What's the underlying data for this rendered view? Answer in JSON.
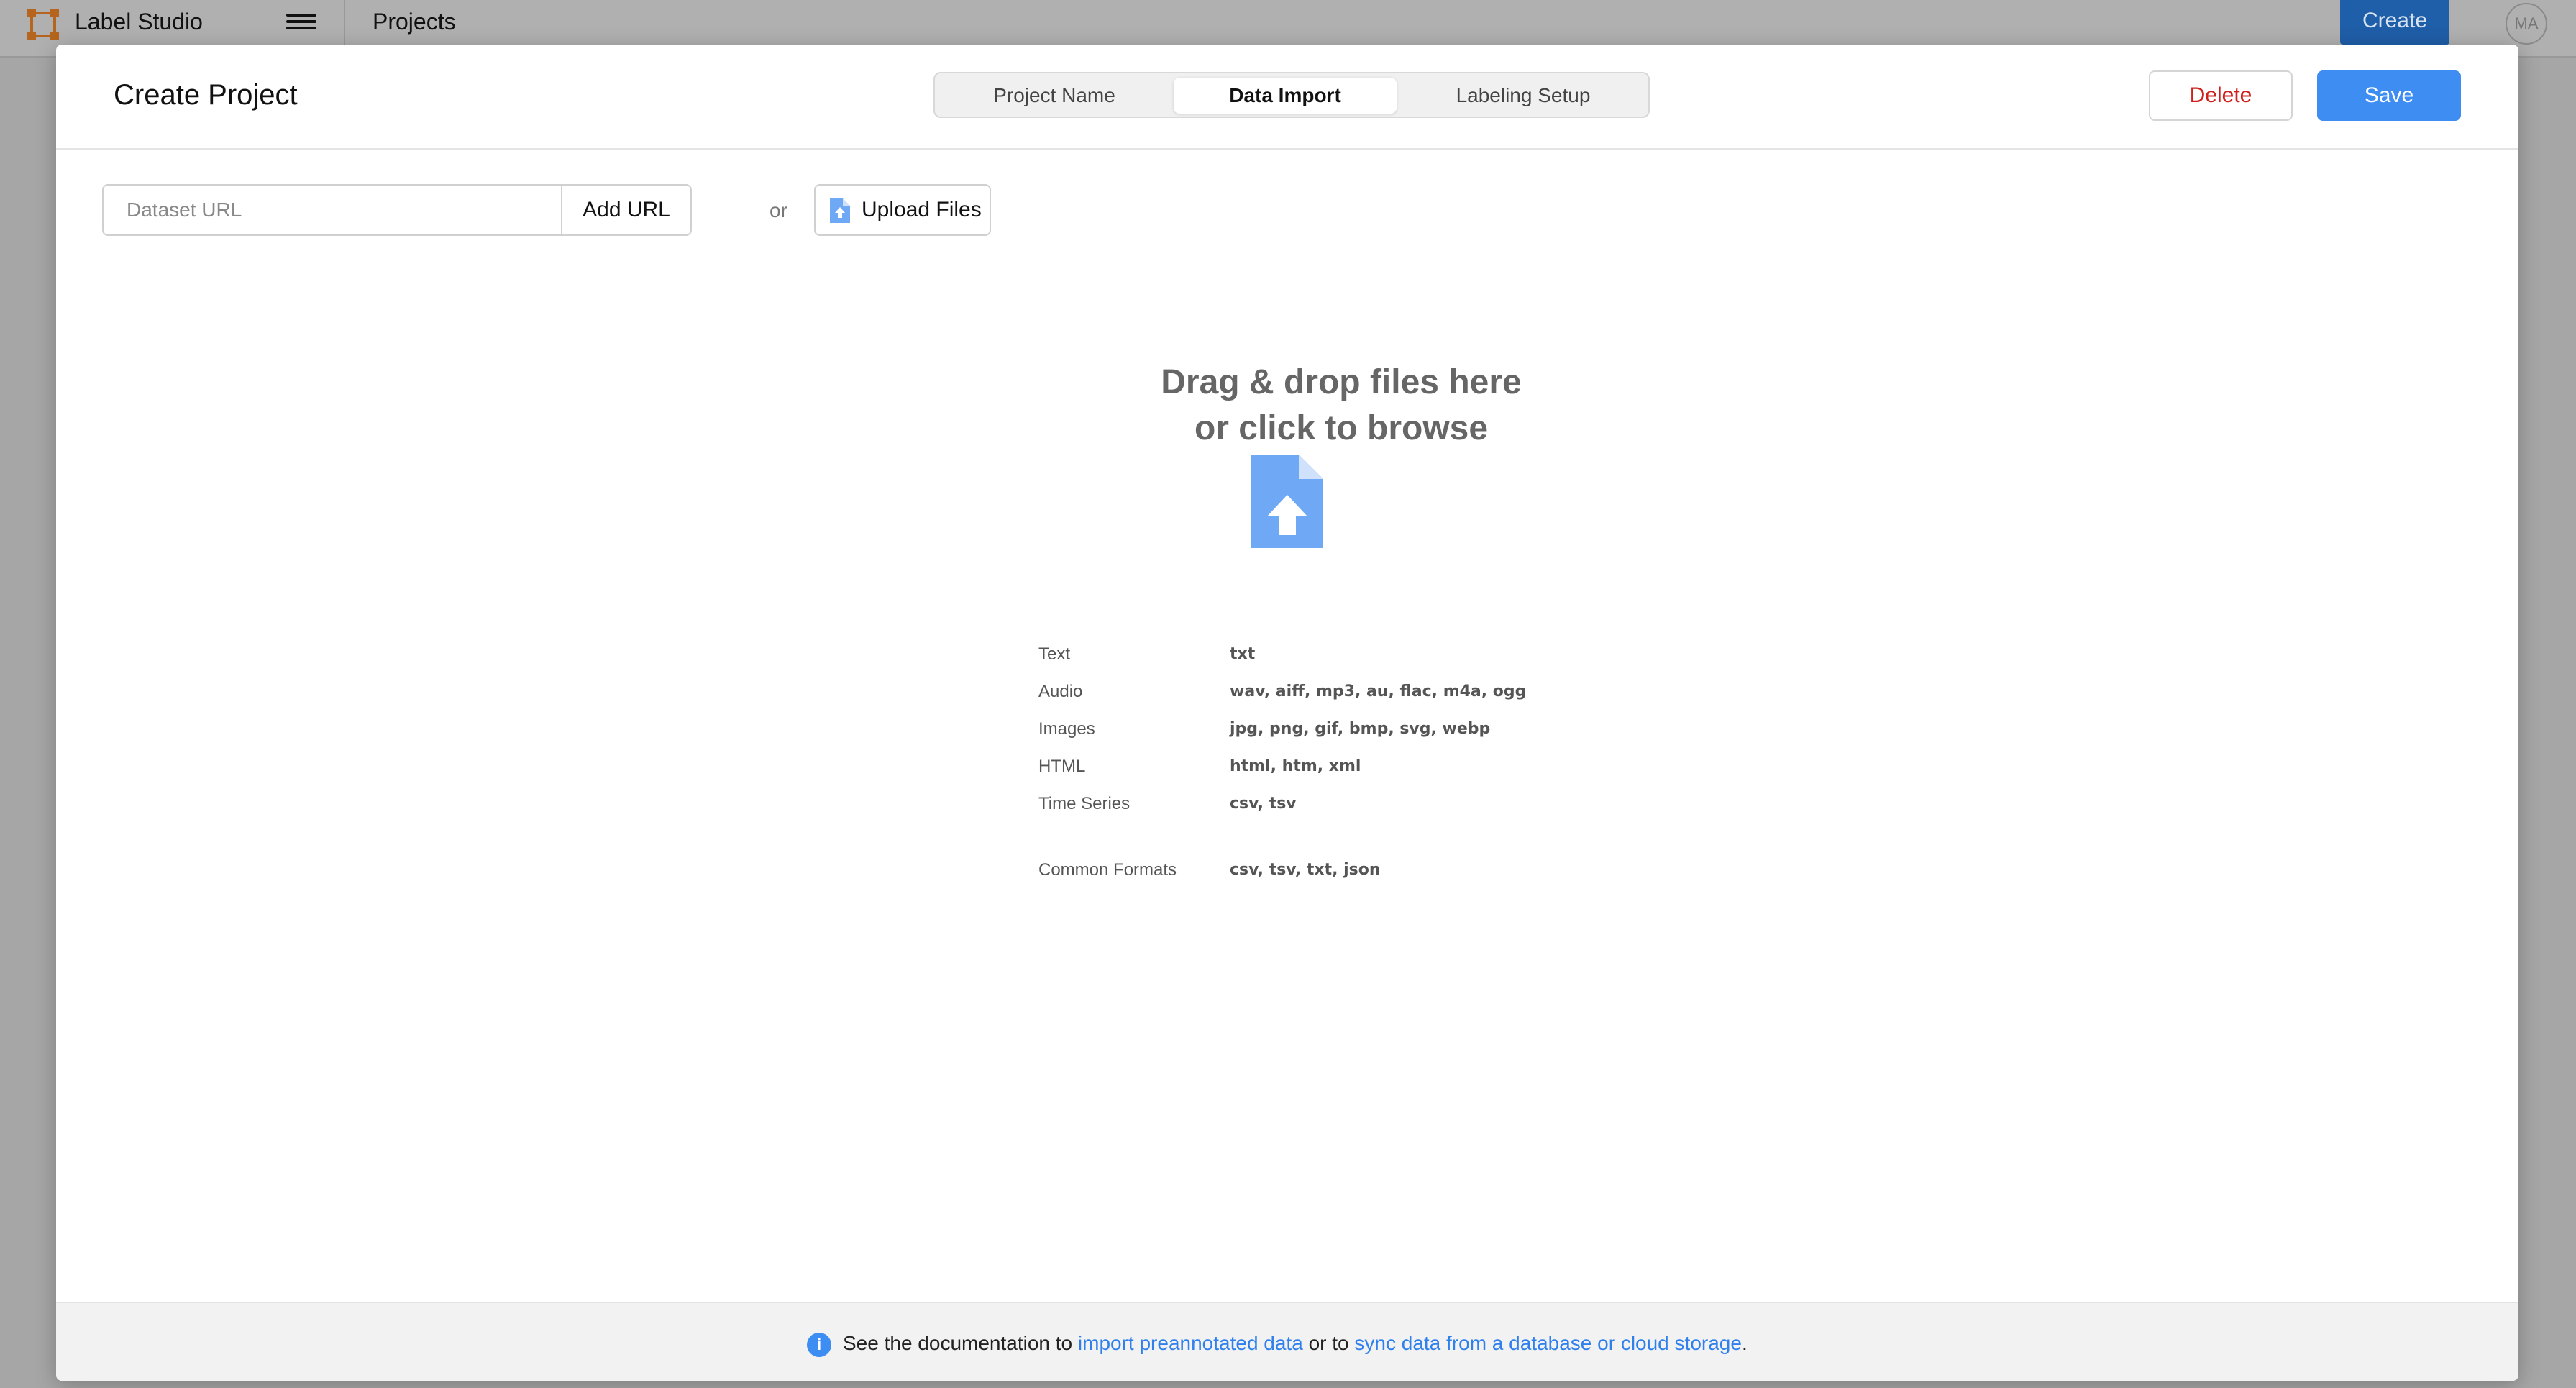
{
  "appbar": {
    "brand": "Label Studio",
    "breadcrumb": "Projects",
    "create_label": "Create",
    "avatar_initials": "MA"
  },
  "modal": {
    "title": "Create Project",
    "tabs": [
      {
        "label": "Project Name"
      },
      {
        "label": "Data Import",
        "active": true
      },
      {
        "label": "Labeling Setup"
      }
    ],
    "delete_label": "Delete",
    "save_label": "Save"
  },
  "import": {
    "url_placeholder": "Dataset URL",
    "url_value": "",
    "add_url_label": "Add URL",
    "or_label": "or",
    "upload_label": "Upload Files"
  },
  "dropzone": {
    "line1": "Drag & drop files here",
    "line2": "or click to browse",
    "formats": [
      {
        "type": "Text",
        "ext": "txt"
      },
      {
        "type": "Audio",
        "ext": "wav, aiff, mp3, au, flac, m4a, ogg"
      },
      {
        "type": "Images",
        "ext": "jpg, png, gif, bmp, svg, webp"
      },
      {
        "type": "HTML",
        "ext": "html, htm, xml"
      },
      {
        "type": "Time Series",
        "ext": "csv, tsv"
      },
      {
        "type": "Common Formats",
        "ext": "csv, tsv, txt, json"
      }
    ]
  },
  "footer": {
    "info_icon": "i",
    "prefix": "See the documentation to ",
    "link1": "import preannotated data",
    "middle": " or to ",
    "link2": "sync data from a database or cloud storage",
    "suffix": "."
  },
  "colors": {
    "accent": "#3d8df2",
    "danger": "#d0201d",
    "link": "#2f80ed",
    "upload_icon": "#6fa8f5"
  }
}
